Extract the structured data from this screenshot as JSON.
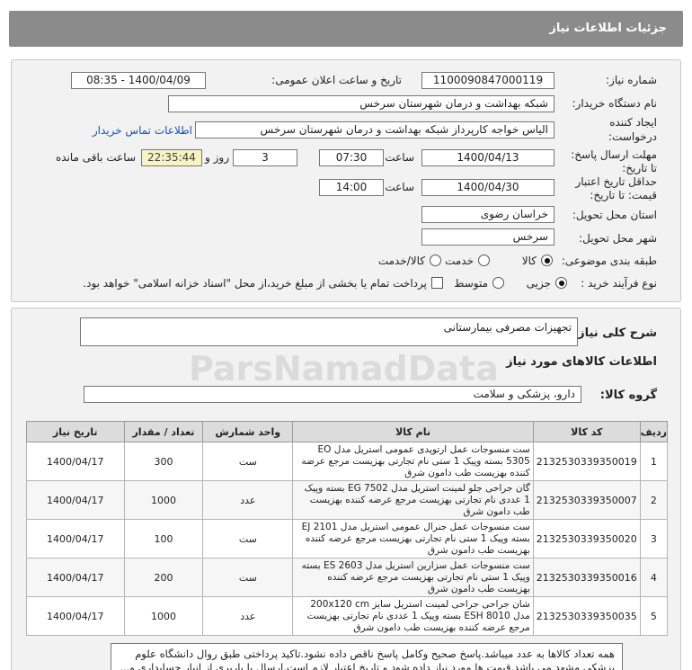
{
  "header": {
    "title": "جزئیات اطلاعات نیاز"
  },
  "need_info": {
    "need_number_label": "شماره نیاز:",
    "need_number": "1100090847000119",
    "announce_label": "تاریخ و ساعت اعلان عمومی:",
    "announce_value": "1400/04/09 - 08:35",
    "buyer_org_label": "نام دستگاه خریدار:",
    "buyer_org": "شبکه بهداشت و درمان شهرستان سرخس",
    "creator_label_1": "ایجاد کننده",
    "creator_label_2": "درخواست:",
    "creator": "الیاس خواجه کارپرداز شبکه بهداشت و درمان شهرستان سرخس",
    "buyer_contact_link": "اطلاعات تماس خریدار",
    "deadline_label_1": "مهلت ارسال پاسخ:",
    "deadline_label_2": "تا تاریخ:",
    "deadline_date": "1400/04/13",
    "time_label": "ساعت",
    "deadline_time": "07:30",
    "days_value": "3",
    "days_label": "روز و",
    "remaining_time": "22:35:44",
    "remaining_label": "ساعت باقی مانده",
    "validity_label_1": "حداقل تاریخ اعتبار",
    "validity_label_2": "قیمت: تا تاریخ:",
    "validity_date": "1400/04/30",
    "validity_time": "14:00",
    "province_label": "استان محل تحویل:",
    "province": "خراسان رضوی",
    "city_label": "شهر محل تحویل:",
    "city": "سرخس",
    "category_label": "طبقه بندی موضوعی:",
    "category_options": [
      "کالا",
      "خدمت",
      "کالا/خدمت"
    ],
    "process_label": "نوع فرآیند خرید :",
    "process_options": [
      "جزیی",
      "متوسط"
    ],
    "payment_note": "پرداخت تمام یا بخشی از مبلغ خرید،از محل \"اسناد خزانه اسلامی\" خواهد بود."
  },
  "description": {
    "label": "شرح کلی نیاز:",
    "value": "تجهیزات مصرفی بیمارستانی"
  },
  "goods": {
    "section_title": "اطلاعات کالاهای مورد نیاز",
    "group_label": "گروه کالا:",
    "group_value": "دارو، پزشکی و سلامت",
    "columns": [
      "ردیف",
      "کد کالا",
      "نام کالا",
      "واحد شمارش",
      "تعداد / مقدار",
      "تاریخ نیاز"
    ],
    "rows": [
      {
        "idx": "1",
        "code": "2132530339350019",
        "name": "ست منسوجات عمل ارتوپدی عمومی استریل مدل EO 5305 بسته وپیک 1 ستی نام تجارتی بهزیست مرجع عرضه کننده بهزیست طب دامون شرق",
        "unit": "ست",
        "qty": "300",
        "date": "1400/04/17"
      },
      {
        "idx": "2",
        "code": "2132530339350007",
        "name": "گان جراحی جلو لمینت استریل مدل EG 7502 بسته وپیک 1 عددی نام تجارتی بهزیست مرجع عرضه کننده بهزیست طب دامون شرق",
        "unit": "عدد",
        "qty": "1000",
        "date": "1400/04/17"
      },
      {
        "idx": "3",
        "code": "2132530339350020",
        "name": "ست منسوجات عمل جنرال عمومی استریل مدل EJ 2101 بسته وپیک 1 ستی نام تجارتی بهزیست مرجع عرضه کننده بهزیست طب دامون شرق",
        "unit": "ست",
        "qty": "100",
        "date": "1400/04/17"
      },
      {
        "idx": "4",
        "code": "2132530339350016",
        "name": "ست منسوجات عمل سزارین استریل مدل ES 2603 بسته وپیک 1 ستی نام تجارتی بهزیست مرجع عرضه کننده بهزیست طب دامون شرق",
        "unit": "ست",
        "qty": "200",
        "date": "1400/04/17"
      },
      {
        "idx": "5",
        "code": "2132530339350035",
        "name": "شان جراحی جراحی لمینت استریل سایز 200x120 cm مدل ESH 8010 بسته وپیک 1 عددی نام تجارتی بهزیست مرجع عرضه کننده بهزیست طب دامون شرق",
        "unit": "عدد",
        "qty": "1000",
        "date": "1400/04/17"
      }
    ]
  },
  "buyer_note": "همه تعداد کالاها به عدد میباشد.پاسخ صحیح وکامل پاسخ ناقص داده نشود.تاکید پرداختی طبق روال دانشگاه علوم پزشکی مشهد می باشد.قیمت ها مورد نیاز داده شود و تاریخ اعتبار لازم است.ارسال با باربری از انبار حسابداری و...",
  "watermark": {
    "brand": "ParsNamadData"
  }
}
